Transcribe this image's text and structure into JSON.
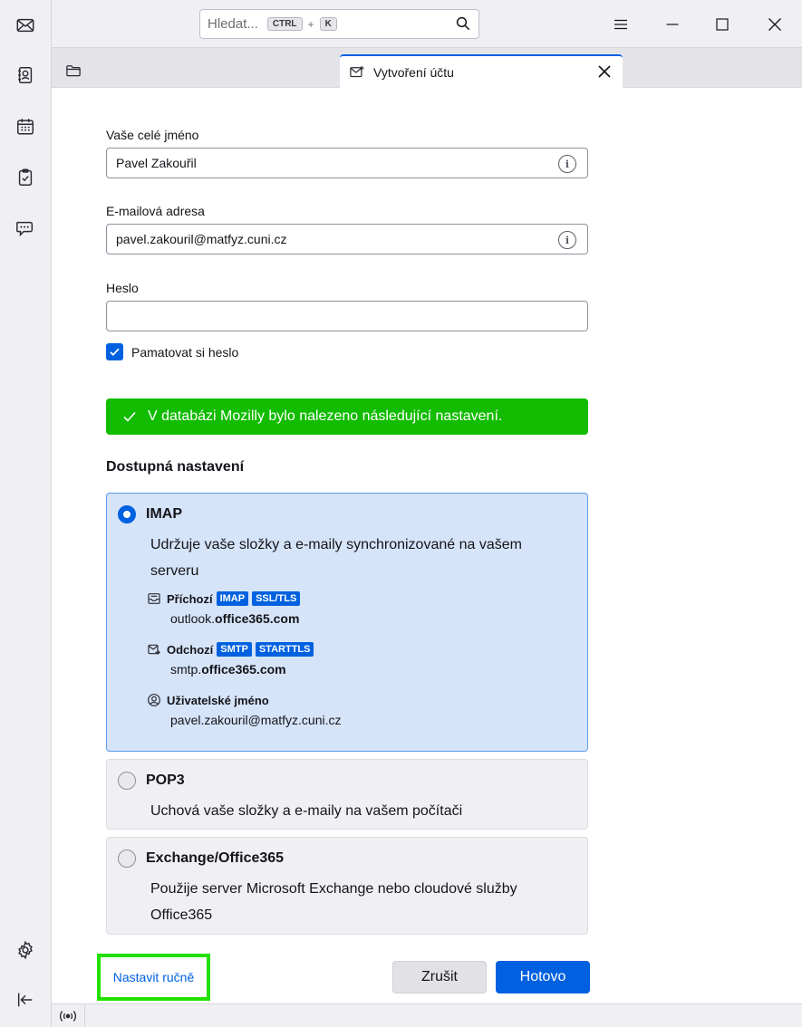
{
  "search": {
    "placeholder": "Hledat...",
    "shortcut_ctrl": "CTRL",
    "shortcut_plus": "+",
    "shortcut_key": "K"
  },
  "tab": {
    "title": "Vytvoření účtu"
  },
  "form": {
    "name_label": "Vaše celé jméno",
    "name_value": "Pavel Zakouřil",
    "email_label": "E-mailová adresa",
    "email_value": "pavel.zakouril@matfyz.cuni.cz",
    "password_label": "Heslo",
    "password_value": "",
    "remember_label": "Pamatovat si heslo",
    "remember_checked": true
  },
  "notice": {
    "text": "V databázi Mozilly bylo nalezeno následující nastavení."
  },
  "settings": {
    "title": "Dostupná nastavení",
    "imap": {
      "name": "IMAP",
      "description": "Udržuje vaše složky a e-maily synchronizované na vašem serveru",
      "incoming_label": "Příchozí",
      "incoming_badge1": "IMAP",
      "incoming_badge2": "SSL/TLS",
      "incoming_host_prefix": "outlook.",
      "incoming_host_domain": "office365.com",
      "outgoing_label": "Odchozí",
      "outgoing_badge1": "SMTP",
      "outgoing_badge2": "STARTTLS",
      "outgoing_host_prefix": "smtp.",
      "outgoing_host_domain": "office365.com",
      "username_label": "Uživatelské jméno",
      "username_value": "pavel.zakouril@matfyz.cuni.cz"
    },
    "pop3": {
      "name": "POP3",
      "description": "Uchová vaše složky a e-maily na vašem počítači"
    },
    "exchange": {
      "name": "Exchange/Office365",
      "description": "Použije server Microsoft Exchange nebo cloudové služby Office365"
    },
    "selected": "IMAP"
  },
  "actions": {
    "manual": "Nastavit ručně",
    "cancel": "Zrušit",
    "done": "Hotovo"
  },
  "colors": {
    "accent": "#0061e0",
    "success": "#12bc00",
    "highlight": "#22e000"
  },
  "icons": [
    "mail-icon",
    "address-book-icon",
    "calendar-icon",
    "tasks-icon",
    "chat-icon",
    "settings-icon",
    "collapse-icon",
    "search-icon",
    "menu-icon",
    "minimize-icon",
    "maximize-icon",
    "close-icon",
    "folder-icon",
    "new-account-icon",
    "info-icon",
    "check-icon",
    "inbox-icon",
    "outbox-icon",
    "user-icon",
    "online-status-icon"
  ]
}
